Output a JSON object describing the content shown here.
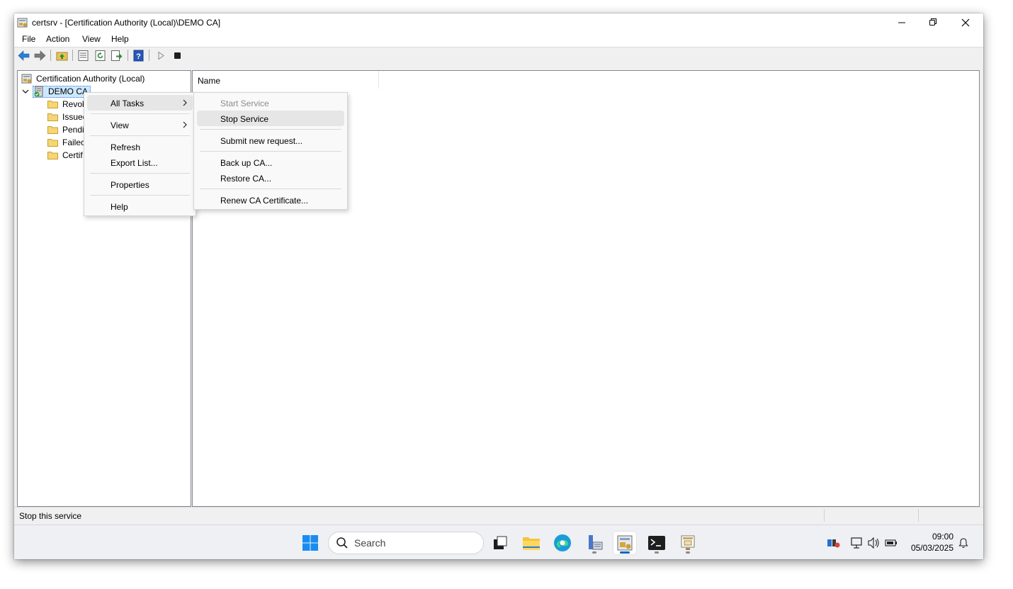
{
  "window": {
    "title": "certsrv - [Certification Authority (Local)\\DEMO CA]"
  },
  "menubar": {
    "items": [
      "File",
      "Action",
      "View",
      "Help"
    ]
  },
  "toolbar": {
    "icons": [
      "back-arrow-icon",
      "forward-arrow-icon",
      "up-folder-icon",
      "properties-icon",
      "refresh-icon",
      "export-icon",
      "help-icon",
      "start-service-icon",
      "stop-service-icon"
    ]
  },
  "tree": {
    "root": "Certification Authority (Local)",
    "ca": "DEMO CA",
    "children": [
      "Revok",
      "Issuec",
      "Pendi",
      "Failec",
      "Certif"
    ]
  },
  "list": {
    "column_name": "Name"
  },
  "context_menu": {
    "all_tasks": "All Tasks",
    "view": "View",
    "refresh": "Refresh",
    "export_list": "Export List...",
    "properties": "Properties",
    "help": "Help"
  },
  "submenu": {
    "start_service": "Start Service",
    "stop_service": "Stop Service",
    "submit_request": "Submit new request...",
    "backup_ca": "Back up CA...",
    "restore_ca": "Restore CA...",
    "renew_cert": "Renew CA Certificate..."
  },
  "statusbar": {
    "text": "Stop this service"
  },
  "taskbar": {
    "search_placeholder": "Search",
    "time": "09:00",
    "date": "05/03/2025"
  },
  "colors": {
    "selection": "#cce8ff",
    "accent": "#0067c0"
  }
}
